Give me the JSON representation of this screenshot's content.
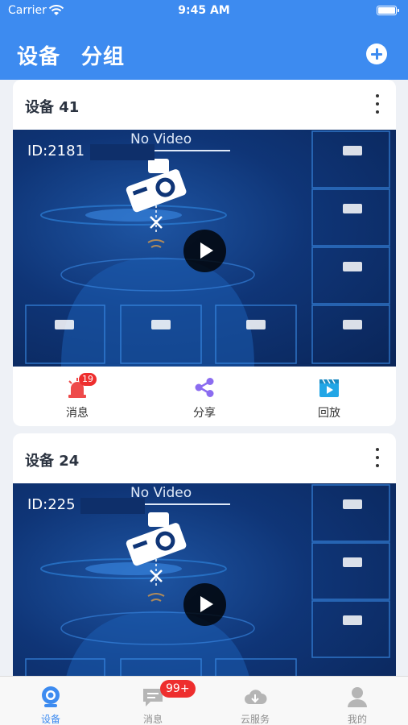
{
  "status_bar": {
    "carrier": "Carrier",
    "time": "9:45 AM"
  },
  "nav": {
    "tab_devices": "设备",
    "tab_groups": "分组",
    "add_icon": "plus-circle-icon"
  },
  "devices": [
    {
      "title": "设备 41",
      "id_text": "ID:2181",
      "no_video": "No Video"
    },
    {
      "title": "设备 24",
      "id_text": "ID:225",
      "no_video": "No Video"
    }
  ],
  "actions": {
    "messages": {
      "label": "消息",
      "badge": "19",
      "icon": "alarm-light-icon"
    },
    "share": {
      "label": "分享",
      "icon": "share-icon"
    },
    "playback": {
      "label": "回放",
      "icon": "video-playback-icon"
    }
  },
  "thumb": {
    "no_video": "No Video"
  },
  "tabbar": {
    "devices": {
      "label": "设备",
      "icon": "camera-icon"
    },
    "messages": {
      "label": "消息",
      "badge": "99+",
      "icon": "chat-icon"
    },
    "cloud": {
      "label": "云服务",
      "icon": "cloud-icon"
    },
    "me": {
      "label": "我的",
      "icon": "user-icon"
    }
  },
  "colors": {
    "primary": "#3d8bf0",
    "badge": "#ee2e2e",
    "video_bg": "#0f3577"
  }
}
